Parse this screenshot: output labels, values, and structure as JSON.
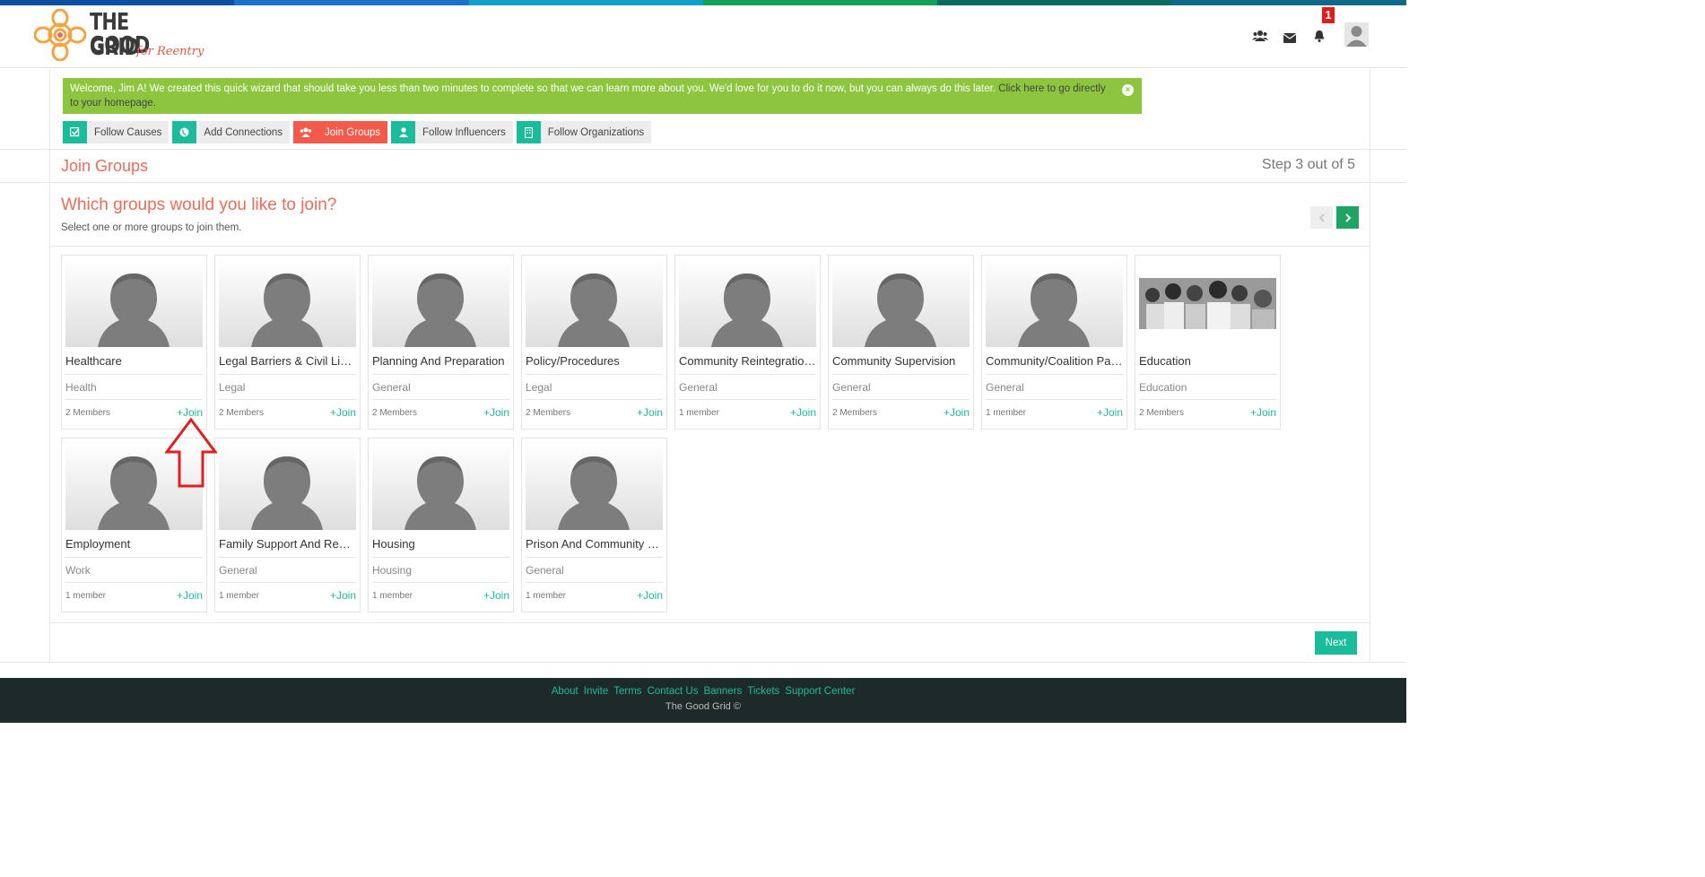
{
  "header": {
    "logo": {
      "line1": "THE GOOD",
      "line2": "GRID",
      "tagline": "for Reentry"
    },
    "notification_count": "1",
    "icons": [
      "users-icon",
      "envelope-icon",
      "bell-icon"
    ]
  },
  "alert": {
    "text": "Welcome, Jim A! We created this quick wizard that should take you less than two minutes to complete so that we can learn more about you. We'd love for you to do it now, but you can always do this later.",
    "link_text": "Click here to go directly to your homepage."
  },
  "steps": [
    {
      "label": "Follow Causes",
      "icon": "check-square-icon",
      "active": false
    },
    {
      "label": "Add Connections",
      "icon": "globe-icon",
      "active": false
    },
    {
      "label": "Join Groups",
      "icon": "users-icon",
      "active": true
    },
    {
      "label": "Follow Influencers",
      "icon": "user-icon",
      "active": false
    },
    {
      "label": "Follow Organizations",
      "icon": "building-icon",
      "active": false
    }
  ],
  "section": {
    "title": "Join Groups",
    "step_count": "Step 3 out of 5"
  },
  "question": {
    "title": "Which groups would you like to join?",
    "subtitle": "Select one or more groups to join them."
  },
  "groups": [
    {
      "name": "Healthcare",
      "category": "Health",
      "members": "2 Members",
      "join": "+Join",
      "photo": false
    },
    {
      "name": "Legal Barriers & Civil Liabil...",
      "category": "Legal",
      "members": "2 Members",
      "join": "+Join",
      "photo": false
    },
    {
      "name": "Planning And Preparation",
      "category": "General",
      "members": "2 Members",
      "join": "+Join",
      "photo": false
    },
    {
      "name": "Policy/Procedures",
      "category": "Legal",
      "members": "2 Members",
      "join": "+Join",
      "photo": false
    },
    {
      "name": "Community Reintegration ...",
      "category": "General",
      "members": "1 member",
      "join": "+Join",
      "photo": false
    },
    {
      "name": "Community Supervision",
      "category": "General",
      "members": "2 Members",
      "join": "+Join",
      "photo": false
    },
    {
      "name": "Community/Coalition Part...",
      "category": "General",
      "members": "1 member",
      "join": "+Join",
      "photo": false
    },
    {
      "name": "Education",
      "category": "Education",
      "members": "2 Members",
      "join": "+Join",
      "photo": true
    },
    {
      "name": "Employment",
      "category": "Work",
      "members": "1 member",
      "join": "+Join",
      "photo": false
    },
    {
      "name": "Family Support And Reunifi...",
      "category": "General",
      "members": "1 member",
      "join": "+Join",
      "photo": false
    },
    {
      "name": "Housing",
      "category": "Housing",
      "members": "1 member",
      "join": "+Join",
      "photo": false
    },
    {
      "name": "Prison And Community Bas...",
      "category": "General",
      "members": "1 member",
      "join": "+Join",
      "photo": false
    }
  ],
  "next_button": "Next",
  "footer": {
    "links": [
      "About",
      "Invite",
      "Terms",
      "Contact Us",
      "Banners",
      "Tickets",
      "Support Center"
    ],
    "copyright": "The Good Grid ©"
  },
  "colors": {
    "accent": "#1abc9c",
    "title": "#ef6b57",
    "alert": "#8cc63f",
    "active_step": "#f25b4b",
    "footer": "#1e2a2a"
  }
}
